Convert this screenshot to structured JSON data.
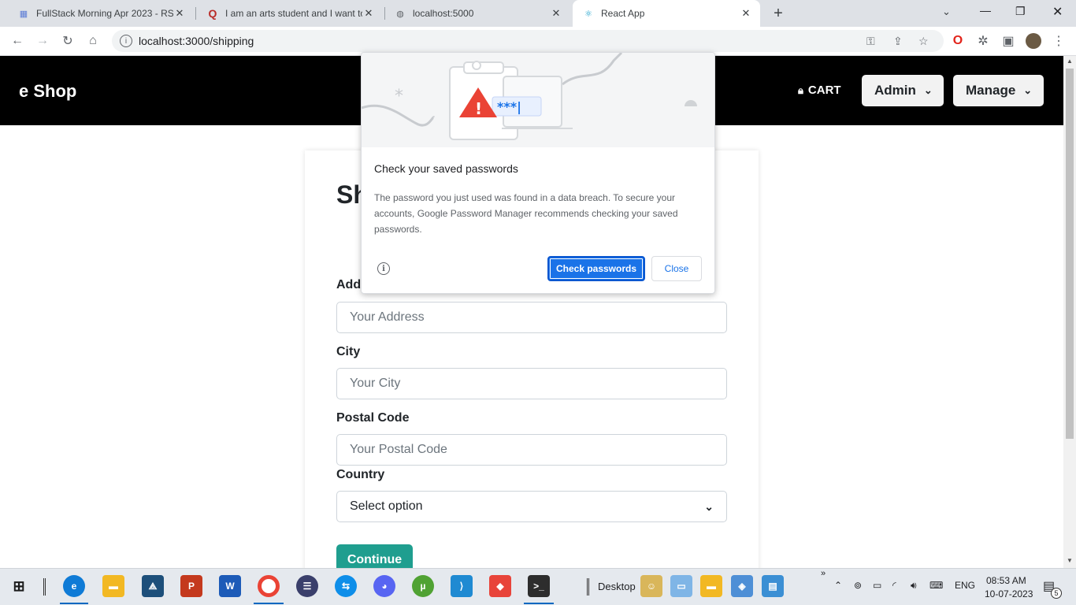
{
  "browser": {
    "tabs": [
      {
        "title": "FullStack Morning Apr 2023 - RST",
        "icon": "grid-icon"
      },
      {
        "title": "I am an arts student and I want to",
        "icon": "quora-icon"
      },
      {
        "title": "localhost:5000",
        "icon": "globe-icon"
      },
      {
        "title": "React App",
        "icon": "react-icon"
      }
    ],
    "new_tab_label": "+",
    "url": "localhost:3000/shipping"
  },
  "navbar": {
    "brand": "e Shop",
    "cart_label": "CART",
    "admin_label": "Admin",
    "manage_label": "Manage"
  },
  "form": {
    "heading": "Sh",
    "address_label": "Addr",
    "address_placeholder": "Your Address",
    "city_label": "City",
    "city_placeholder": "Your City",
    "postal_label": "Postal Code",
    "postal_placeholder": "Your Postal Code",
    "country_label": "Country",
    "country_value": "Select option",
    "continue_label": "Continue"
  },
  "popup": {
    "title": "Check your saved passwords",
    "body": "The password you just used was found in a data breach. To secure your accounts, Google Password Manager recommends checking your saved passwords.",
    "primary_button": "Check passwords",
    "secondary_button": "Close",
    "password_mask": "***|"
  },
  "taskbar": {
    "desktop_label": "Desktop",
    "language": "ENG",
    "time": "08:53 AM",
    "date": "10-07-2023",
    "notification_count": "5"
  },
  "colors": {
    "accent": "#1a73e8",
    "navbar_bg": "#000000",
    "continue_bg": "#1f9e8f"
  }
}
